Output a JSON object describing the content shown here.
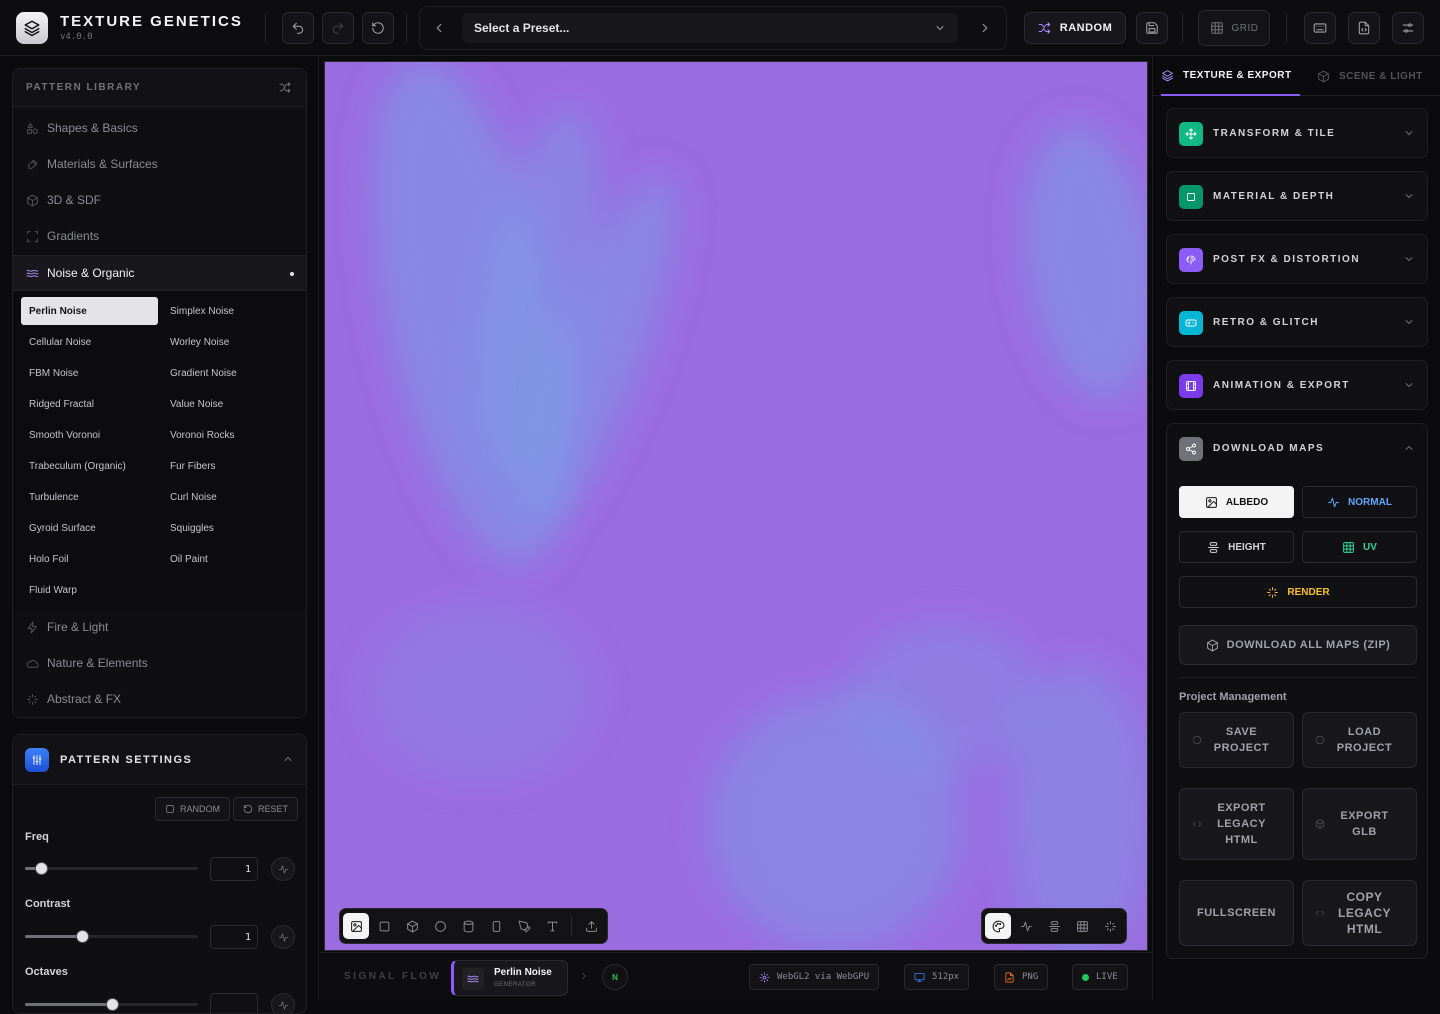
{
  "app": {
    "name": "TEXTURE GENETICS",
    "version": "v4.0.0"
  },
  "toolbar": {
    "preset_placeholder": "Select a Preset...",
    "random_label": "RANDOM",
    "grid_label": "GRID",
    "icons": [
      "undo-icon",
      "redo-icon",
      "reset-icon",
      "save-icon",
      "keyboard-icon",
      "file-code-icon",
      "sliders-icon"
    ]
  },
  "library": {
    "title": "PATTERN LIBRARY",
    "categories": [
      {
        "label": "Shapes & Basics",
        "icon": "shapes-icon"
      },
      {
        "label": "Materials & Surfaces",
        "icon": "brush-icon"
      },
      {
        "label": "3D & SDF",
        "icon": "cube-icon"
      },
      {
        "label": "Gradients",
        "icon": "scan-icon"
      },
      {
        "label": "Noise & Organic",
        "icon": "waves-icon",
        "active": true
      },
      {
        "label": "Fire & Light",
        "icon": "flame-icon"
      },
      {
        "label": "Nature & Elements",
        "icon": "cloud-icon"
      },
      {
        "label": "Abstract & FX",
        "icon": "sparkles-icon"
      }
    ],
    "patterns": [
      "Perlin Noise",
      "Simplex Noise",
      "Cellular Noise",
      "Worley Noise",
      "FBM Noise",
      "Gradient Noise",
      "Ridged Fractal",
      "Value Noise",
      "Smooth Voronoi",
      "Voronoi Rocks",
      "Trabeculum (Organic)",
      "Fur Fibers",
      "Turbulence",
      "Curl Noise",
      "Gyroid Surface",
      "Squiggles",
      "Holo Foil",
      "Oil Paint",
      "Fluid Warp"
    ],
    "selected_pattern": "Perlin Noise"
  },
  "settings": {
    "title": "PATTERN SETTINGS",
    "random_label": "RANDOM",
    "reset_label": "RESET",
    "params": [
      {
        "label": "Freq",
        "value": "1",
        "level": 0.09
      },
      {
        "label": "Contrast",
        "value": "1",
        "level": 0.33
      },
      {
        "label": "Octaves",
        "value": "",
        "level": 0.5
      }
    ]
  },
  "viewport": {
    "base_color": "#9b6be0",
    "cloud_color": "#7aa0e8",
    "left_tools": [
      "image-icon",
      "square-icon",
      "cube-icon",
      "circle-icon",
      "cylinder-icon",
      "rectangle-icon",
      "pen-icon",
      "text-icon",
      "export-icon"
    ],
    "right_tools": [
      "palette-icon",
      "activity-icon",
      "layers-icon",
      "grid-icon",
      "sparkles-icon"
    ]
  },
  "signal": {
    "title": "SIGNAL FLOW",
    "node_name": "Perlin Noise",
    "node_type": "GENERATOR",
    "next_node": "N",
    "renderer": "WebGL2 via WebGPU",
    "resolution": "512px",
    "format": "PNG",
    "status": "LIVE"
  },
  "right": {
    "tab_active": "TEXTURE & EXPORT",
    "tab_other": "SCENE & LIGHT",
    "sections": [
      {
        "title": "TRANSFORM & TILE",
        "color": "#10b981"
      },
      {
        "title": "MATERIAL & DEPTH",
        "color": "#059669"
      },
      {
        "title": "POST FX & DISTORTION",
        "color": "#8b5cf6"
      },
      {
        "title": "RETRO & GLITCH",
        "color": "#06b6d4"
      },
      {
        "title": "ANIMATION & EXPORT",
        "color": "#7c3aed"
      }
    ],
    "download": {
      "title": "DOWNLOAD MAPS",
      "albedo": "ALBEDO",
      "normal": "NORMAL",
      "height": "HEIGHT",
      "uv": "UV",
      "render": "RENDER",
      "download_all": "DOWNLOAD ALL MAPS (ZIP)"
    },
    "project": {
      "title": "Project Management",
      "save": "SAVE\nPROJECT",
      "load": "LOAD\nPROJECT",
      "export_html": "EXPORT\nLEGACY\nHTML",
      "export_glb": "EXPORT\nGLB",
      "fullscreen": "FULLSCREEN",
      "copy_html": "COPY\nLEGACY\nHTML"
    }
  }
}
